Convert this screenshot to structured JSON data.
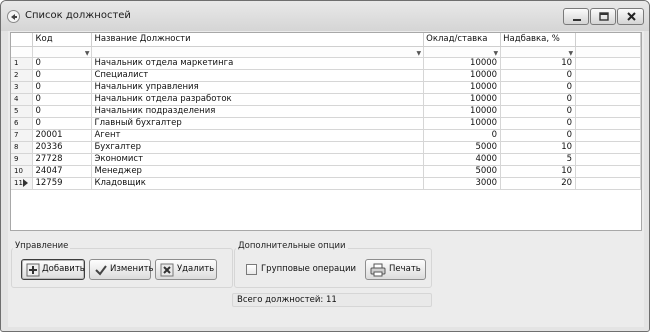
{
  "window": {
    "title": "Список должностей",
    "controls": [
      "minimize",
      "maximize",
      "close"
    ]
  },
  "grid": {
    "columns": [
      "Код",
      "Название Должности",
      "Оклад/ставка",
      "Надбавка, %"
    ],
    "rows": [
      {
        "n": "1",
        "code": "0",
        "name": "Начальник отдела маркетинга",
        "salary": "10000",
        "bonus": "10"
      },
      {
        "n": "2",
        "code": "0",
        "name": "Специалист",
        "salary": "10000",
        "bonus": "0"
      },
      {
        "n": "3",
        "code": "0",
        "name": "Начальник управления",
        "salary": "10000",
        "bonus": "0"
      },
      {
        "n": "4",
        "code": "0",
        "name": "Начальник отдела разработок",
        "salary": "10000",
        "bonus": "0"
      },
      {
        "n": "5",
        "code": "0",
        "name": "Начальник подразделения",
        "salary": "10000",
        "bonus": "0"
      },
      {
        "n": "6",
        "code": "0",
        "name": "Главный бухгалтер",
        "salary": "10000",
        "bonus": "0"
      },
      {
        "n": "7",
        "code": "20001",
        "name": "Агент",
        "salary": "0",
        "bonus": "0"
      },
      {
        "n": "8",
        "code": "20336",
        "name": "Бухгалтер",
        "salary": "5000",
        "bonus": "10"
      },
      {
        "n": "9",
        "code": "27728",
        "name": "Экономист",
        "salary": "4000",
        "bonus": "5"
      },
      {
        "n": "10",
        "code": "24047",
        "name": "Менеджер",
        "salary": "5000",
        "bonus": "10"
      },
      {
        "n": "11",
        "code": "12759",
        "name": "Кладовщик",
        "salary": "3000",
        "bonus": "20"
      }
    ],
    "selected_row": "11"
  },
  "management": {
    "label": "Управление",
    "add": "Добавить",
    "edit": "Изменить",
    "delete": "Удалить"
  },
  "options": {
    "label": "Дополнительные опции",
    "group_ops": "Групповые операции",
    "group_ops_checked": false,
    "print": "Печать"
  },
  "status": {
    "total": "Всего должностей: 11"
  }
}
